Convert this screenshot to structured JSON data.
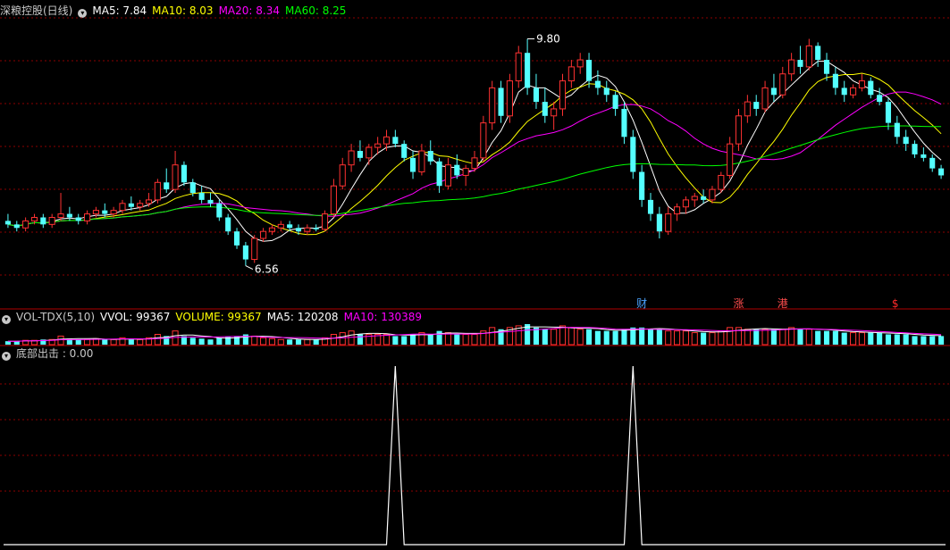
{
  "main_panel": {
    "title": "深粮控股(日线)",
    "indicators": [
      {
        "label": "MA5: 7.84",
        "color": "#ffffff"
      },
      {
        "label": "MA10: 8.03",
        "color": "#ffff00"
      },
      {
        "label": "MA20: 8.34",
        "color": "#ff00ff"
      },
      {
        "label": "MA60: 8.25",
        "color": "#00ff00"
      }
    ],
    "high_label": "9.80",
    "low_label": "6.56",
    "markers": [
      {
        "text": "财",
        "color": "#4aa3ff"
      },
      {
        "text": "涨",
        "color": "#ff4d4d"
      },
      {
        "text": "港",
        "color": "#ff4d4d"
      },
      {
        "text": "$",
        "color": "#ff2a2a"
      }
    ]
  },
  "vol_panel": {
    "indicators": [
      {
        "label": "VOL-TDX(5,10)",
        "color": "#c8c8c8"
      },
      {
        "label": "VVOL: 99367",
        "color": "#ffffff"
      },
      {
        "label": "VOLUME: 99367",
        "color": "#ffff00"
      },
      {
        "label": "MA5: 120208",
        "color": "#ffffff"
      },
      {
        "label": "MA10: 130389",
        "color": "#ff00ff"
      }
    ]
  },
  "signal_panel": {
    "indicator": {
      "label": "底部出击 : 0.00",
      "color": "#c8c8c8"
    }
  },
  "colors": {
    "up": "#ff3232",
    "down": "#54ffff",
    "grid": "#8b0000",
    "ma5": "#ffffff",
    "ma10": "#ffff00",
    "ma20": "#ff00ff",
    "ma60": "#00ff00",
    "signal": "#ffffff"
  },
  "chart_data": {
    "type": "candlestick",
    "price_range": [
      6.3,
      10.1
    ],
    "series": [
      {
        "name": "K",
        "values": [
          [
            7.2,
            7.3,
            7.1,
            7.15
          ],
          [
            7.15,
            7.2,
            7.05,
            7.1
          ],
          [
            7.1,
            7.25,
            7.05,
            7.2
          ],
          [
            7.2,
            7.3,
            7.15,
            7.25
          ],
          [
            7.25,
            7.3,
            7.1,
            7.15
          ],
          [
            7.15,
            7.3,
            7.1,
            7.25
          ],
          [
            7.25,
            7.6,
            7.2,
            7.3
          ],
          [
            7.3,
            7.4,
            7.2,
            7.25
          ],
          [
            7.25,
            7.3,
            7.15,
            7.2
          ],
          [
            7.2,
            7.35,
            7.15,
            7.3
          ],
          [
            7.3,
            7.4,
            7.25,
            7.35
          ],
          [
            7.35,
            7.45,
            7.25,
            7.3
          ],
          [
            7.3,
            7.4,
            7.25,
            7.35
          ],
          [
            7.35,
            7.5,
            7.3,
            7.45
          ],
          [
            7.45,
            7.55,
            7.35,
            7.4
          ],
          [
            7.4,
            7.5,
            7.35,
            7.45
          ],
          [
            7.45,
            7.6,
            7.4,
            7.5
          ],
          [
            7.5,
            7.8,
            7.45,
            7.75
          ],
          [
            7.75,
            7.95,
            7.6,
            7.65
          ],
          [
            7.65,
            8.2,
            7.6,
            8.0
          ],
          [
            8.0,
            8.05,
            7.7,
            7.75
          ],
          [
            7.75,
            7.8,
            7.55,
            7.6
          ],
          [
            7.6,
            7.7,
            7.45,
            7.5
          ],
          [
            7.5,
            7.6,
            7.4,
            7.45
          ],
          [
            7.45,
            7.5,
            7.2,
            7.25
          ],
          [
            7.25,
            7.3,
            7.0,
            7.05
          ],
          [
            7.05,
            7.1,
            6.8,
            6.85
          ],
          [
            6.85,
            6.9,
            6.56,
            6.65
          ],
          [
            6.65,
            7.0,
            6.6,
            6.95
          ],
          [
            6.95,
            7.1,
            6.9,
            7.05
          ],
          [
            7.05,
            7.15,
            7.0,
            7.1
          ],
          [
            7.1,
            7.2,
            7.05,
            7.15
          ],
          [
            7.15,
            7.2,
            7.05,
            7.1
          ],
          [
            7.1,
            7.15,
            7.0,
            7.05
          ],
          [
            7.05,
            7.15,
            7.0,
            7.1
          ],
          [
            7.1,
            7.15,
            7.05,
            7.08
          ],
          [
            7.08,
            7.35,
            7.05,
            7.3
          ],
          [
            7.3,
            7.8,
            7.25,
            7.7
          ],
          [
            7.7,
            8.1,
            7.65,
            8.0
          ],
          [
            8.0,
            8.3,
            7.9,
            8.2
          ],
          [
            8.2,
            8.35,
            8.05,
            8.1
          ],
          [
            8.1,
            8.3,
            8.0,
            8.25
          ],
          [
            8.25,
            8.4,
            8.15,
            8.3
          ],
          [
            8.3,
            8.5,
            8.2,
            8.4
          ],
          [
            8.4,
            8.5,
            8.25,
            8.3
          ],
          [
            8.3,
            8.35,
            8.05,
            8.1
          ],
          [
            8.1,
            8.2,
            7.8,
            7.9
          ],
          [
            7.9,
            8.3,
            7.85,
            8.2
          ],
          [
            8.2,
            8.35,
            8.0,
            8.05
          ],
          [
            8.05,
            8.1,
            7.6,
            7.7
          ],
          [
            7.7,
            8.1,
            7.65,
            8.0
          ],
          [
            8.0,
            8.15,
            7.8,
            7.85
          ],
          [
            7.85,
            8.0,
            7.7,
            7.95
          ],
          [
            7.95,
            8.2,
            7.9,
            8.1
          ],
          [
            8.1,
            8.7,
            8.05,
            8.6
          ],
          [
            8.6,
            9.2,
            8.5,
            9.1
          ],
          [
            9.1,
            9.2,
            8.6,
            8.7
          ],
          [
            8.7,
            9.3,
            8.6,
            9.2
          ],
          [
            9.2,
            9.7,
            9.1,
            9.6
          ],
          [
            9.6,
            9.8,
            9.0,
            9.1
          ],
          [
            9.1,
            9.3,
            8.8,
            8.9
          ],
          [
            8.9,
            9.1,
            8.6,
            8.7
          ],
          [
            8.7,
            8.9,
            8.5,
            8.8
          ],
          [
            8.8,
            9.3,
            8.7,
            9.2
          ],
          [
            9.2,
            9.5,
            9.1,
            9.4
          ],
          [
            9.4,
            9.6,
            9.3,
            9.5
          ],
          [
            9.5,
            9.6,
            9.1,
            9.2
          ],
          [
            9.2,
            9.35,
            9.0,
            9.1
          ],
          [
            9.1,
            9.2,
            8.9,
            9.0
          ],
          [
            9.0,
            9.05,
            8.7,
            8.8
          ],
          [
            8.8,
            8.9,
            8.3,
            8.4
          ],
          [
            8.4,
            8.5,
            7.8,
            7.9
          ],
          [
            7.9,
            8.0,
            7.4,
            7.5
          ],
          [
            7.5,
            7.6,
            7.2,
            7.3
          ],
          [
            7.3,
            7.4,
            6.95,
            7.05
          ],
          [
            7.05,
            7.4,
            7.0,
            7.3
          ],
          [
            7.3,
            7.45,
            7.2,
            7.4
          ],
          [
            7.4,
            7.55,
            7.3,
            7.5
          ],
          [
            7.5,
            7.6,
            7.4,
            7.55
          ],
          [
            7.55,
            7.65,
            7.45,
            7.5
          ],
          [
            7.5,
            7.7,
            7.45,
            7.65
          ],
          [
            7.65,
            7.9,
            7.6,
            7.85
          ],
          [
            7.85,
            8.4,
            7.8,
            8.3
          ],
          [
            8.3,
            8.8,
            8.2,
            8.7
          ],
          [
            8.7,
            9.0,
            8.6,
            8.9
          ],
          [
            8.9,
            9.0,
            8.7,
            8.8
          ],
          [
            8.8,
            9.2,
            8.75,
            9.1
          ],
          [
            9.1,
            9.3,
            8.9,
            9.0
          ],
          [
            9.0,
            9.4,
            8.95,
            9.3
          ],
          [
            9.3,
            9.6,
            9.2,
            9.5
          ],
          [
            9.5,
            9.7,
            9.3,
            9.4
          ],
          [
            9.4,
            9.8,
            9.35,
            9.7
          ],
          [
            9.7,
            9.75,
            9.4,
            9.5
          ],
          [
            9.5,
            9.6,
            9.2,
            9.3
          ],
          [
            9.3,
            9.4,
            9.0,
            9.1
          ],
          [
            9.1,
            9.2,
            8.9,
            9.0
          ],
          [
            9.0,
            9.15,
            8.95,
            9.1
          ],
          [
            9.1,
            9.3,
            9.05,
            9.2
          ],
          [
            9.2,
            9.25,
            8.95,
            9.0
          ],
          [
            9.0,
            9.1,
            8.85,
            8.9
          ],
          [
            8.9,
            8.95,
            8.5,
            8.6
          ],
          [
            8.6,
            8.7,
            8.3,
            8.4
          ],
          [
            8.4,
            8.5,
            8.2,
            8.3
          ],
          [
            8.3,
            8.35,
            8.1,
            8.15
          ],
          [
            8.15,
            8.25,
            8.05,
            8.1
          ],
          [
            8.1,
            8.15,
            7.9,
            7.95
          ],
          [
            7.95,
            8.0,
            7.8,
            7.85
          ]
        ]
      }
    ],
    "volume_range": [
      0,
      1
    ],
    "volumes": [
      0.2,
      0.2,
      0.25,
      0.25,
      0.3,
      0.3,
      0.5,
      0.35,
      0.3,
      0.3,
      0.35,
      0.3,
      0.3,
      0.4,
      0.3,
      0.3,
      0.4,
      0.6,
      0.5,
      0.8,
      0.5,
      0.4,
      0.35,
      0.3,
      0.4,
      0.45,
      0.5,
      0.6,
      0.5,
      0.4,
      0.35,
      0.3,
      0.3,
      0.3,
      0.3,
      0.3,
      0.4,
      0.6,
      0.7,
      0.8,
      0.6,
      0.6,
      0.6,
      0.6,
      0.5,
      0.5,
      0.6,
      0.7,
      0.6,
      0.8,
      0.7,
      0.6,
      0.6,
      0.6,
      0.8,
      1.0,
      0.9,
      1.0,
      1.1,
      1.2,
      1.0,
      0.9,
      0.9,
      1.1,
      1.0,
      0.9,
      0.9,
      0.8,
      0.8,
      0.8,
      0.9,
      1.0,
      1.0,
      0.9,
      0.9,
      0.8,
      0.8,
      0.8,
      0.7,
      0.7,
      0.7,
      0.8,
      1.0,
      1.0,
      0.9,
      0.9,
      0.9,
      0.9,
      0.9,
      1.0,
      0.9,
      0.9,
      0.8,
      0.8,
      0.8,
      0.7,
      0.7,
      0.7,
      0.7,
      0.7,
      0.6,
      0.6,
      0.6,
      0.5,
      0.5,
      0.5,
      0.5
    ],
    "signal_range": [
      0,
      1
    ],
    "signal_peaks": [
      [
        44,
        1
      ],
      [
        71,
        1
      ]
    ]
  }
}
